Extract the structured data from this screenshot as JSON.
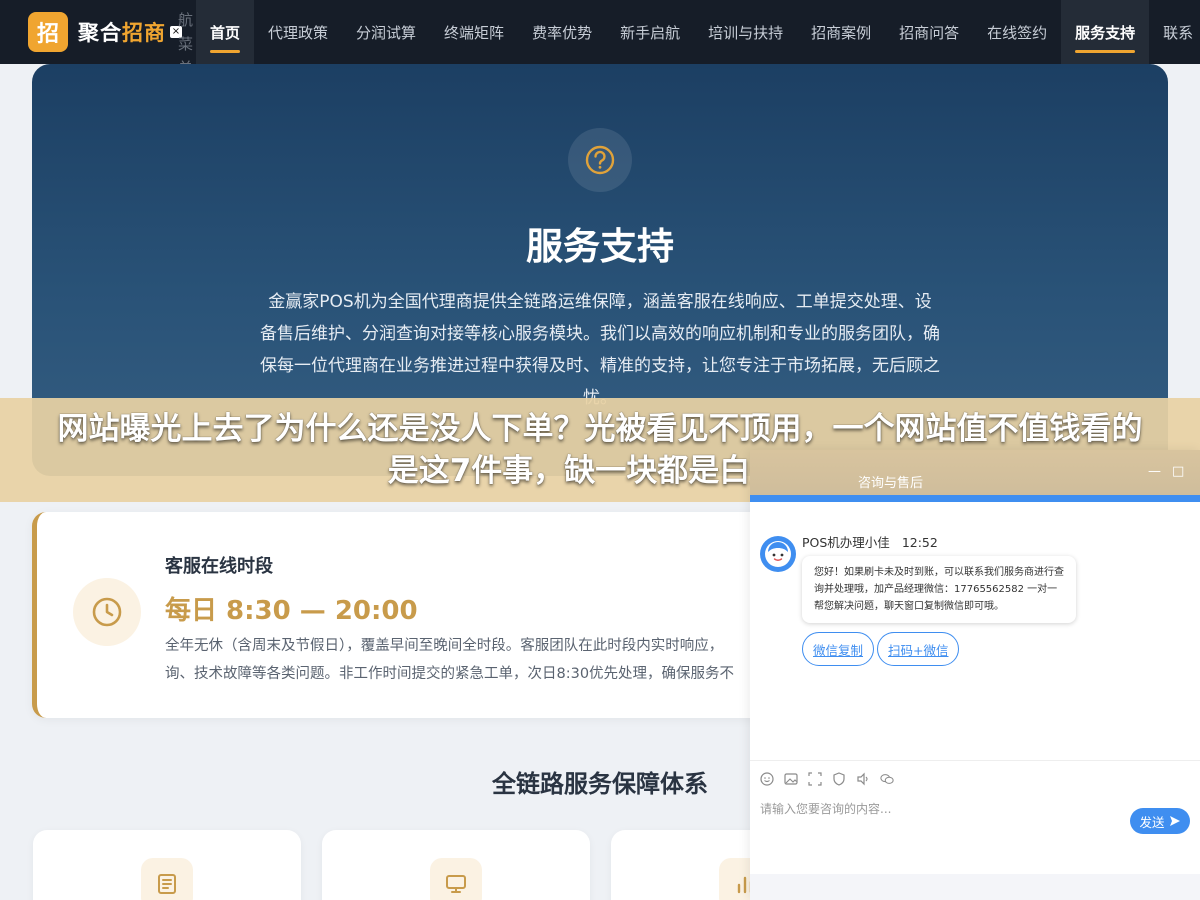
{
  "nav": {
    "logo_char": "招",
    "brand_part1": "聚合",
    "brand_part2": "招商",
    "close_glyph": "×",
    "menu_label": "航菜单",
    "items": [
      {
        "label": "首页",
        "active": true
      },
      {
        "label": "代理政策"
      },
      {
        "label": "分润试算"
      },
      {
        "label": "终端矩阵"
      },
      {
        "label": "费率优势"
      },
      {
        "label": "新手启航"
      },
      {
        "label": "培训与扶持"
      },
      {
        "label": "招商案例"
      },
      {
        "label": "招商问答"
      },
      {
        "label": "在线签约"
      },
      {
        "label": "服务支持",
        "active": true
      },
      {
        "label": "联系"
      }
    ],
    "accent": "#f0a530"
  },
  "hero": {
    "icon": "question-circle-icon",
    "title": "服务支持",
    "description": "金赢家POS机为全国代理商提供全链路运维保障，涵盖客服在线响应、工单提交处理、设备售后维护、分润查询对接等核心服务模块。我们以高效的响应机制和专业的服务团队，确保每一位代理商在业务推进过程中获得及时、精准的支持，让您专注于市场拓展，无后顾之忧。"
  },
  "banner": {
    "text": "网站曝光上去了为什么还是没人下单？光被看见不顶用，一个网站值不值钱看的是这7件事，缺一块都是白烧钱"
  },
  "service_card": {
    "icon": "clock-icon",
    "title": "客服在线时段",
    "hours": "每日 8:30 — 20:00",
    "description_line1": "全年无休（含周末及节假日），覆盖早间至晚间全时段。客服团队在此时段内实时响应，",
    "description_line2": "询、技术故障等各类问题。非工作时间提交的紧急工单，次日8:30优先处理，确保服务不",
    "accent": "#c89b4b"
  },
  "section": {
    "title": "全链路服务保障体系",
    "features": [
      {
        "icon": "document-icon"
      },
      {
        "icon": "monitor-icon"
      },
      {
        "icon": "bar-chart-icon"
      }
    ]
  },
  "chat": {
    "header_title": "咨询与售后",
    "minimize_glyph": "—",
    "maximize_glyph": "□",
    "agent_name": "POS机办理小佳",
    "time": "12:52",
    "message": "您好！如果刷卡未及时到账，可以联系我们服务商进行查询并处理哦，加产品经理微信：17765562582 一对一帮您解决问题，聊天窗口复制微信即可哦。",
    "chip1": "微信复制",
    "chip2": "扫码+微信",
    "tools": [
      "emoji-icon",
      "image-icon",
      "screenshot-icon",
      "shield-icon",
      "volume-icon",
      "wechat-icon"
    ],
    "input_placeholder": "请输入您要咨询的内容...",
    "send_label": "发送",
    "accent": "#3f8ef0"
  }
}
